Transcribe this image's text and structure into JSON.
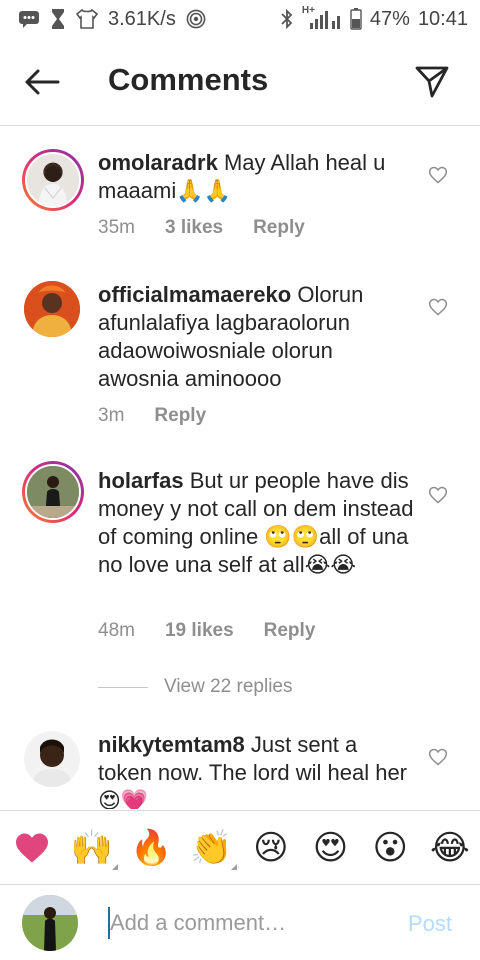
{
  "status_bar": {
    "net_speed": "3.61K/s",
    "network_type": "H+",
    "battery": "47%",
    "time": "10:41",
    "icons": [
      "message-icon",
      "hourglass-icon",
      "shirt-icon",
      "hotspot-icon",
      "bluetooth-icon",
      "signal-icon",
      "battery-icon"
    ]
  },
  "header": {
    "title": "Comments",
    "back_icon": "arrow-left-icon",
    "send_icon": "paper-plane-icon"
  },
  "comments": [
    {
      "username": "omolaradrk",
      "text": "May Allah heal u maaami🙏🙏",
      "time": "35m",
      "likes": "3 likes",
      "reply": "Reply"
    },
    {
      "username": "officialmamaereko",
      "text": "Olorun afunlalafiya lagbaraolorun adaowoiwosniale olorun awosnia aminoooo",
      "time": "3m",
      "likes": "",
      "reply": "Reply"
    },
    {
      "username": "holarfas",
      "text": "But ur people have dis money y not call on dem instead of coming online 🙄🙄all of una no love una self at all😭😭",
      "time": "48m",
      "likes": "19 likes",
      "reply": "Reply"
    },
    {
      "username": "nikkytemtam8",
      "text": "Just sent a token now. The lord wil heal her😍💗",
      "time": "",
      "likes": "",
      "reply": ""
    }
  ],
  "view_replies": "View 22 replies",
  "emoji_bar": [
    "❤",
    "🙌",
    "🔥",
    "👏",
    "😢",
    "😍",
    "😮",
    "😂"
  ],
  "composer": {
    "placeholder": "Add a comment…",
    "post_label": "Post"
  },
  "colors": {
    "text": "#262626",
    "meta": "#8e8e8e",
    "divider": "#dbdbdb",
    "post": "#b3dbff",
    "heart": "#e0457b"
  }
}
